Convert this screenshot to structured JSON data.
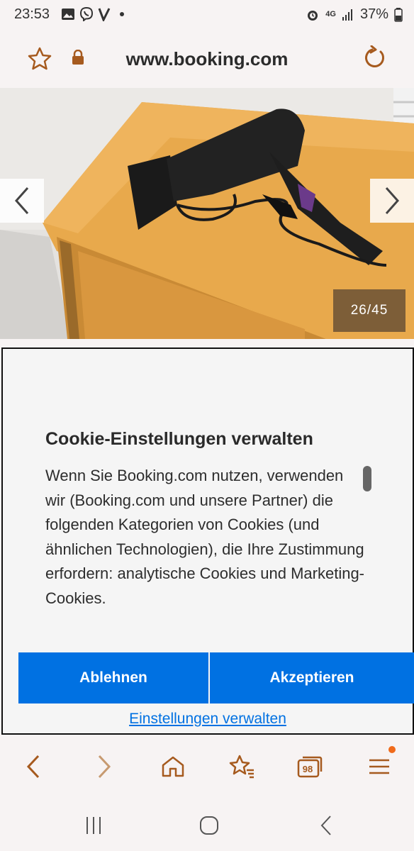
{
  "status_bar": {
    "time": "23:53",
    "network": "4G",
    "battery": "37%",
    "left_icons": [
      "gallery-icon",
      "viber-icon",
      "v-app-icon",
      "dot-icon"
    ],
    "right_icons": [
      "alarm-icon",
      "network-4g-icon",
      "signal-icon",
      "battery-icon"
    ]
  },
  "browser": {
    "url": "www.booking.com",
    "icons": [
      "star-icon",
      "lock-icon",
      "reload-icon"
    ]
  },
  "gallery": {
    "counter": "26/45",
    "current": 26,
    "total": 45
  },
  "cookie_dialog": {
    "title": "Cookie-Einstellungen verwalten",
    "body": "Wenn Sie Booking.com nutzen, verwenden wir (Booking.com und unsere Partner) die folgenden Kategorien von Cookies (und ähnlichen Technologien), die Ihre Zustimmung erfordern: analytische Cookies und Marketing-Cookies.",
    "decline_label": "Ablehnen",
    "accept_label": "Akzeptieren",
    "manage_label": "Einstellungen verwalten"
  },
  "bottom_nav": {
    "tabs_count": "98",
    "items": [
      "back-icon",
      "forward-icon",
      "home-icon",
      "bookmarks-icon",
      "tabs-icon",
      "menu-icon"
    ]
  },
  "colors": {
    "accent": "#0071e2",
    "browser_icons": "#a65a1e",
    "background": "#f7f3f3"
  }
}
